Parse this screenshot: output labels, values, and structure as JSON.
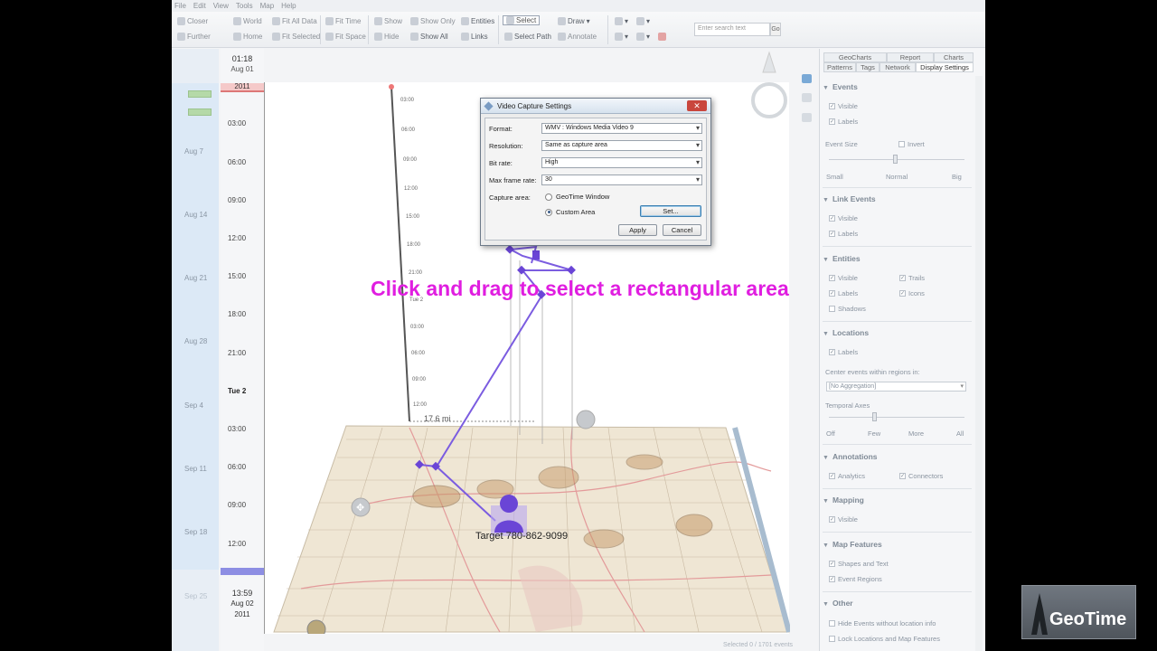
{
  "menu": [
    "File",
    "Edit",
    "View",
    "Tools",
    "Map",
    "Help"
  ],
  "toolbar": {
    "closer": "Closer",
    "further": "Further",
    "world": "World",
    "home": "Home",
    "fit_all_data": "Fit All Data",
    "fit_selected": "Fit Selected",
    "fit_time": "Fit Time",
    "fit_space": "Fit Space",
    "show": "Show",
    "hide": "Hide",
    "show_only": "Show Only",
    "show_all": "Show All",
    "entities": "Entities",
    "links": "Links",
    "select": "Select",
    "select_path": "Select Path",
    "draw": "Draw",
    "annotate": "Annotate",
    "search_placeholder": "Enter search text",
    "go": "Go"
  },
  "timeline": {
    "top_time": "01:18",
    "top_date": "Aug 01",
    "top_year": "2011",
    "bottom_time": "13:59",
    "bottom_date": "Aug 02",
    "bottom_year": "2011",
    "left_dates": [
      "Aug 7",
      "Aug 14",
      "Aug 21",
      "Aug 28",
      "Sep 4",
      "Sep 11",
      "Sep 18",
      "Sep 25"
    ],
    "hours": [
      "03:00",
      "06:00",
      "09:00",
      "12:00",
      "15:00",
      "18:00",
      "21:00",
      "Tue 2",
      "03:00",
      "06:00",
      "09:00",
      "12:00"
    ]
  },
  "map": {
    "overlay_instruction": "Click and drag to select a rectangular area",
    "target_label": "Target 780-862-9099",
    "distance": "17.6 mi",
    "axis_ticks": [
      "03:00",
      "06:00",
      "09:00",
      "12:00",
      "15:00",
      "18:00",
      "21:00",
      "Tue 2",
      "03:00",
      "06:00",
      "09:00",
      "12:00"
    ]
  },
  "dialog": {
    "title": "Video Capture Settings",
    "close": "✕",
    "format_label": "Format:",
    "format_value": "WMV : Windows Media Video 9",
    "resolution_label": "Resolution:",
    "resolution_value": "Same as capture area",
    "bitrate_label": "Bit rate:",
    "bitrate_value": "High",
    "framerate_label": "Max frame rate:",
    "framerate_value": "30",
    "capture_label": "Capture area:",
    "option_geotime": "GeoTime Window",
    "option_custom": "Custom Area",
    "set_button": "Set...",
    "apply_button": "Apply",
    "cancel_button": "Cancel"
  },
  "panel": {
    "tabs_top": [
      "GeoCharts",
      "Report",
      "Charts"
    ],
    "tabs_bottom": [
      "Patterns",
      "Tags",
      "Network",
      "Display Settings"
    ],
    "events": {
      "title": "Events",
      "visible": "Visible",
      "labels": "Labels",
      "size_label": "Event Size",
      "invert": "Invert",
      "small": "Small",
      "normal": "Normal",
      "big": "Big"
    },
    "link_events": {
      "title": "Link Events",
      "visible": "Visible",
      "labels": "Labels"
    },
    "entities": {
      "title": "Entities",
      "visible": "Visible",
      "trails": "Trails",
      "labels": "Labels",
      "icons": "Icons",
      "shadows": "Shadows"
    },
    "locations": {
      "title": "Locations",
      "labels": "Labels",
      "center_label": "Center events within regions in:",
      "aggregation": "[No Aggregation]",
      "temporal_axes": "Temporal Axes",
      "off": "Off",
      "few": "Few",
      "more": "More",
      "all": "All"
    },
    "annotations": {
      "title": "Annotations",
      "analytics": "Analytics",
      "connectors": "Connectors"
    },
    "mapping": {
      "title": "Mapping",
      "visible": "Visible"
    },
    "map_features": {
      "title": "Map Features",
      "shapes": "Shapes and Text",
      "regions": "Event Regions"
    },
    "other": {
      "title": "Other",
      "hide_events": "Hide Events without location info",
      "lock": "Lock Locations and Map Features"
    }
  },
  "status": "Selected 0 / 1701 events",
  "logo": "GeoTime",
  "colors": {
    "accent": "#e01ee0",
    "path": "#7b5ce0",
    "entity": "#6a45d6",
    "region": "#c79a6a"
  }
}
